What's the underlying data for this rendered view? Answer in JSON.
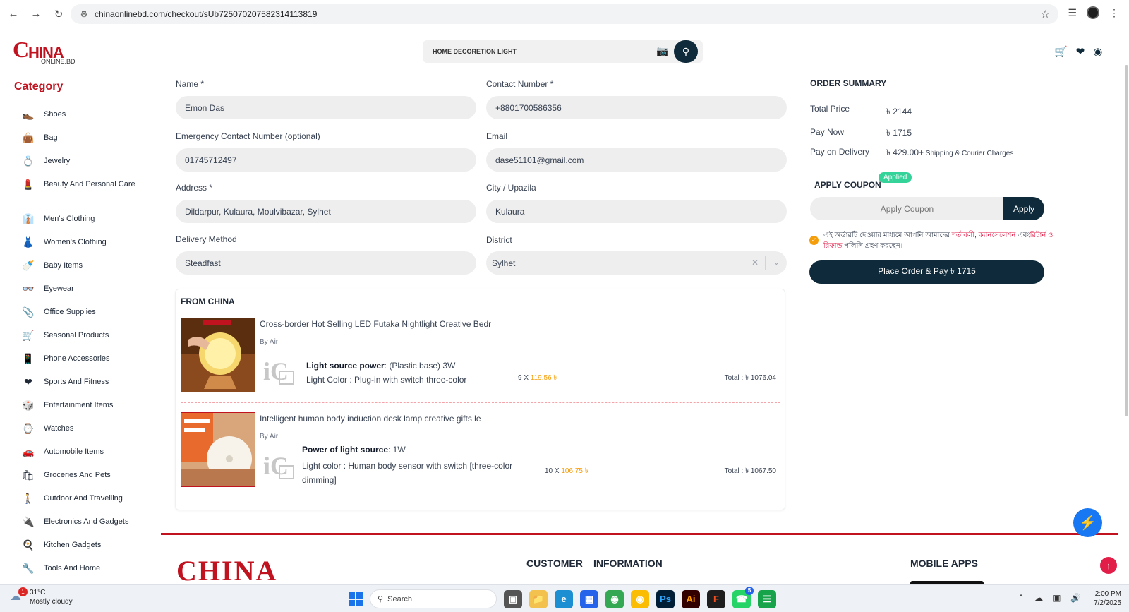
{
  "browser": {
    "url": "chinaonlinebd.com/checkout/sUb72507020758231411381​9"
  },
  "header": {
    "logo_main": "C",
    "logo_hina": "HINA",
    "logo_sub": "ONLINE.BD",
    "search_value": "HOME DECORETION LIGHT"
  },
  "sidebar": {
    "title": "Category",
    "items": [
      {
        "label": "Shoes",
        "icon": "shoe-icon",
        "glyph": "👞"
      },
      {
        "label": "Bag",
        "icon": "bag-icon",
        "glyph": "👜"
      },
      {
        "label": "Jewelry",
        "icon": "jewelry-icon",
        "glyph": "💍"
      },
      {
        "label": "Beauty And Personal Care",
        "icon": "beauty-icon",
        "glyph": "💄"
      },
      {
        "label": "Men's Clothing",
        "icon": "mens-clothing-icon",
        "glyph": "👔"
      },
      {
        "label": "Women's Clothing",
        "icon": "womens-clothing-icon",
        "glyph": "👗"
      },
      {
        "label": "Baby Items",
        "icon": "baby-icon",
        "glyph": "🍼"
      },
      {
        "label": "Eyewear",
        "icon": "eyewear-icon",
        "glyph": "👓"
      },
      {
        "label": "Office Supplies",
        "icon": "office-icon",
        "glyph": "📎"
      },
      {
        "label": "Seasonal Products",
        "icon": "seasonal-icon",
        "glyph": "🛒"
      },
      {
        "label": "Phone Accessories",
        "icon": "phone-icon",
        "glyph": "📱"
      },
      {
        "label": "Sports And Fitness",
        "icon": "sports-icon",
        "glyph": "❤"
      },
      {
        "label": "Entertainment Items",
        "icon": "entertainment-icon",
        "glyph": "🎲"
      },
      {
        "label": "Watches",
        "icon": "watch-icon",
        "glyph": "⌚"
      },
      {
        "label": "Automobile Items",
        "icon": "car-icon",
        "glyph": "🚗"
      },
      {
        "label": "Groceries And Pets",
        "icon": "groceries-icon",
        "glyph": "🛍"
      },
      {
        "label": "Outdoor And Travelling",
        "icon": "travel-icon",
        "glyph": "🚶"
      },
      {
        "label": "Electronics And Gadgets",
        "icon": "electronics-icon",
        "glyph": "🔌"
      },
      {
        "label": "Kitchen Gadgets",
        "icon": "kitchen-icon",
        "glyph": "🍳"
      },
      {
        "label": "Tools And Home",
        "icon": "tools-icon",
        "glyph": "🔧"
      }
    ]
  },
  "form": {
    "name_label": "Name *",
    "name_value": "Emon Das",
    "contact_label": "Contact Number *",
    "contact_value": "+8801700586356",
    "emergency_label": "Emergency Contact Number (optional)",
    "emergency_value": "01745712497",
    "email_label": "Email",
    "email_value": "dase51101@gmail.com",
    "address_label": "Address *",
    "address_value": "Dildarpur, Kulaura, Moulvibazar, Sylhet",
    "city_label": "City / Upazila",
    "city_value": "Kulaura",
    "delivery_label": "Delivery Method",
    "delivery_value": "Steadfast",
    "district_label": "District",
    "district_value": "Sylhet"
  },
  "order": {
    "section_title": "FROM CHINA",
    "items": [
      {
        "title": "Cross-border Hot Selling LED Futaka Nightlight Creative Bedr",
        "by": "By Air",
        "attr1_key": "Light source power",
        "attr1_val": ": (Plastic base) 3W",
        "attr2": "Light Color : Plug-in with switch three-color",
        "qty_prefix": "9 X ",
        "unit_price": "119.56 ৳",
        "total": "Total : ৳ 1076.04"
      },
      {
        "title": "Intelligent human body induction desk lamp creative gifts le",
        "by": "By Air",
        "attr1_key": "Power of light source",
        "attr1_val": ": 1W",
        "attr2": "Light color : Human body sensor with switch [three-color dimming]",
        "qty_prefix": "10 X ",
        "unit_price": "106.75 ৳",
        "total": "Total : ৳ 1067.50"
      }
    ]
  },
  "summary": {
    "title": "ORDER SUMMARY",
    "total_label": "Total Price",
    "total_value": "৳ 2144",
    "paynow_label": "Pay Now",
    "paynow_value": "৳ 1715",
    "pod_label": "Pay on Delivery",
    "pod_value": "৳ 429.00+",
    "pod_note": " Shipping & Courier Charges",
    "coupon_title": "APPLY COUPON",
    "applied_badge": "Applied",
    "coupon_placeholder": "Apply Coupon",
    "apply_label": "Apply",
    "terms_part1": "এই অর্ডারটি দেওয়ার মাধ্যমে আপনি আমাদের ",
    "terms_link1": "শর্তাবলী",
    "terms_sep": ", ",
    "terms_link2": "ক্যানসেলেশন",
    "terms_and": " এবং",
    "terms_link3": "রিটার্ন ও রিফান্ড",
    "terms_part2": " পলিসি গ্রহণ করছেন।",
    "place_order_label": "Place Order & Pay ৳ 1715"
  },
  "footer": {
    "logo_text": "CHINA",
    "customer_heading": "CUSTOMER",
    "information_heading": "INFORMATION",
    "mobile_heading": "MOBILE APPS"
  },
  "taskbar": {
    "temp": "31°C",
    "weather": "Mostly cloudy",
    "weather_badge": "1",
    "search_label": "Search",
    "time": "2:00 PM",
    "date": "7/2/2025",
    "whatsapp_badge": "5"
  },
  "colors": {
    "brand_red": "#c1121f",
    "dark_navy": "#0f2a3a",
    "price_orange": "#f59e0b",
    "applied_green": "#34d399"
  }
}
